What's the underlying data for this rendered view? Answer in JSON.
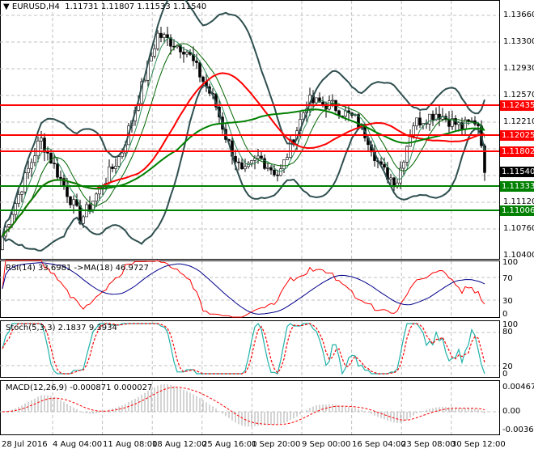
{
  "header": {
    "symbol": "EURUSD,H4",
    "open": "1.11731",
    "high": "1.11807",
    "low": "1.11533",
    "close": "1.11540"
  },
  "price_axis": [
    "1.13660",
    "1.13300",
    "1.12930",
    "1.12570",
    "1.12210",
    "1.11480",
    "1.11120",
    "1.10760",
    "1.10400"
  ],
  "levels": [
    {
      "value": "1.12435",
      "color": "#ff0000"
    },
    {
      "value": "1.12025",
      "color": "#ff0000"
    },
    {
      "value": "1.11802",
      "color": "#ff0000"
    },
    {
      "value": "1.11333",
      "color": "#008000"
    },
    {
      "value": "1.11006",
      "color": "#008000"
    }
  ],
  "current_price": "1.11540",
  "rsi": {
    "label": "RSI(14) 33.6981  ->MA(18) 46.9727",
    "axis": [
      "100",
      "70",
      "30",
      "0"
    ]
  },
  "stoch": {
    "label": "Stoch(5,3,3) 2.1837 9.3934",
    "axis": [
      "100",
      "80",
      "20",
      "0"
    ]
  },
  "macd": {
    "label": "MACD(12,26,9) -0.000871 0.000027",
    "axis": [
      "0.004673",
      "0.00",
      "-0.003696"
    ]
  },
  "time_axis": [
    "28 Jul 2016",
    "4 Aug 04:00",
    "11 Aug 08:00",
    "18 Aug 12:00",
    "25 Aug 16:00",
    "1 Sep 20:00",
    "9 Sep 00:00",
    "16 Sep 04:00",
    "23 Sep 08:00",
    "30 Sep 12:00"
  ],
  "price_path": [
    [
      0,
      1.106
    ],
    [
      50,
      1.12
    ],
    [
      100,
      1.109
    ],
    [
      150,
      1.118
    ],
    [
      195,
      1.134
    ],
    [
      230,
      1.132
    ],
    [
      265,
      1.125
    ],
    [
      280,
      1.12
    ],
    [
      300,
      1.115
    ],
    [
      320,
      1.1175
    ],
    [
      345,
      1.115
    ],
    [
      380,
      1.125
    ],
    [
      410,
      1.1245
    ],
    [
      440,
      1.1225
    ],
    [
      455,
      1.12
    ],
    [
      470,
      1.116
    ],
    [
      490,
      1.114
    ],
    [
      510,
      1.122
    ],
    [
      540,
      1.1235
    ],
    [
      570,
      1.1215
    ],
    [
      590,
      1.1225
    ],
    [
      603,
      1.1154
    ]
  ]
}
